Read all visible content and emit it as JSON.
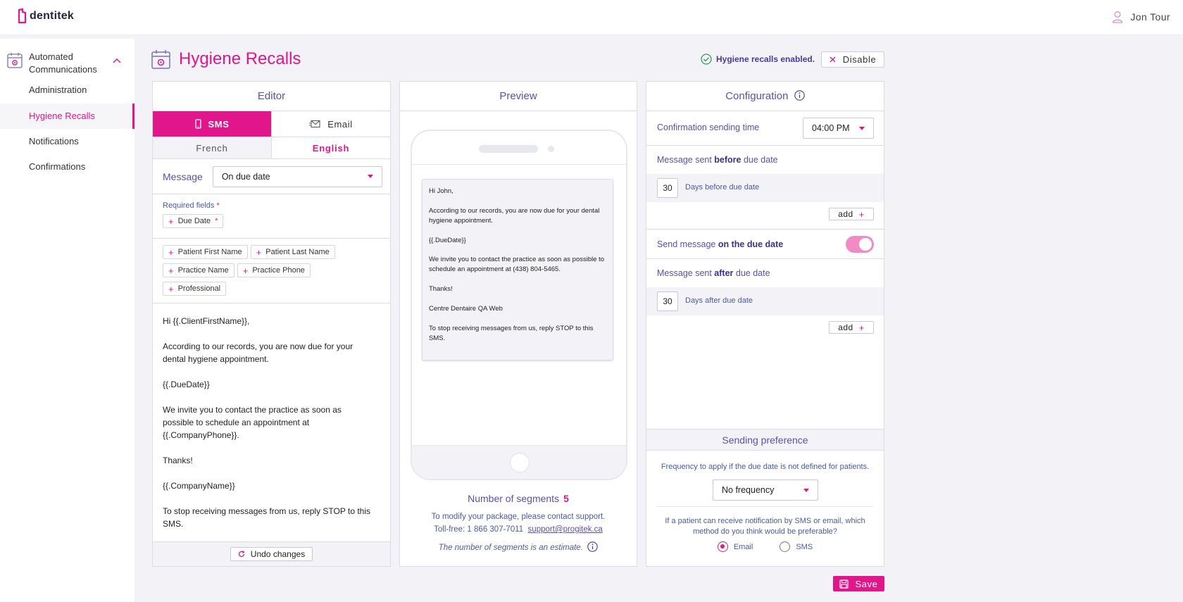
{
  "app": {
    "logo_text": "dentitek",
    "user_name": "Jon Tour"
  },
  "sidebar": {
    "section_label": "Automated Communications",
    "items": [
      {
        "label": "Administration"
      },
      {
        "label": "Hygiene Recalls"
      },
      {
        "label": "Notifications"
      },
      {
        "label": "Confirmations"
      }
    ]
  },
  "page": {
    "title": "Hygiene Recalls",
    "status": "Hygiene recalls enabled.",
    "disable_label": "Disable",
    "save_label": "Save"
  },
  "editor": {
    "title": "Editor",
    "tab_sms": "SMS",
    "tab_email": "Email",
    "lang_french": "French",
    "lang_english": "English",
    "message_label": "Message",
    "message_value": "On due date",
    "required_label": "Required fields",
    "required_chip": "Due Date",
    "chips": [
      "Patient First Name",
      "Patient Last Name",
      "Practice Name",
      "Practice Phone",
      "Professional"
    ],
    "body": [
      "Hi {{.ClientFirstName}},",
      "According to our records, you are now due for your dental hygiene appointment.",
      "{{.DueDate}}",
      "We invite you to contact the practice as soon as possible to schedule an appointment at {{.CompanyPhone}}.",
      "Thanks!",
      "{{.CompanyName}}",
      "To stop receiving messages from us, reply STOP to this SMS."
    ],
    "undo_label": "Undo changes"
  },
  "preview": {
    "title": "Preview",
    "message": [
      "Hi John,",
      "According to our records, you are now due for your dental hygiene appointment.",
      "{{.DueDate}}",
      "We invite you to contact the practice as soon as possible to schedule an appointment at (438) 804-5465.",
      "Thanks!",
      "Centre Dentaire QA Web",
      "To stop receiving messages from us, reply STOP to this SMS."
    ],
    "segments_label": "Number of segments",
    "segments_count": "5",
    "package_text": "To modify your package, please contact support.",
    "tollfree_text": "Toll-free: 1 866 307-7011",
    "support_email": "support@progitek.ca",
    "estimate_text": "The number of segments is an estimate."
  },
  "config": {
    "title": "Configuration",
    "sending_time_label": "Confirmation sending time",
    "sending_time_value": "04:00 PM",
    "before_label_pre": "Message sent ",
    "before_label_bold": "before",
    "before_label_post": " due date",
    "before_days": "30",
    "before_days_label": "Days before due date",
    "add_label": "add",
    "ondate_label_pre": "Send message ",
    "ondate_label_bold": "on the due date",
    "ondate_enabled": true,
    "after_label_pre": "Message sent ",
    "after_label_bold": "after",
    "after_label_post": " due date",
    "after_days": "30",
    "after_days_label": "Days after due date",
    "pref_title": "Sending preference",
    "frequency_text": "Frequency to apply if the due date is not defined for patients.",
    "frequency_value": "No frequency",
    "method_question": "If a patient can receive notification by SMS or email, which method do you think would be preferable?",
    "method_options": [
      "Email",
      "SMS"
    ],
    "method_selected": "Email"
  },
  "colors": {
    "accent": "#e0168a",
    "primary_text": "#5b4fb0",
    "toggle_on": "#f08cc3"
  }
}
